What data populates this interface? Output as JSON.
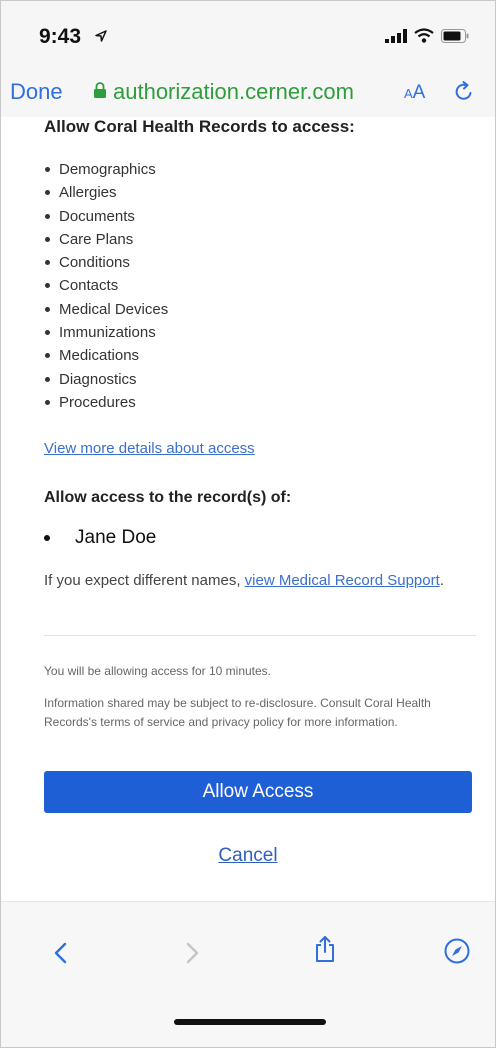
{
  "status_bar": {
    "time": "9:43"
  },
  "browser": {
    "done_label": "Done",
    "url": "authorization.cerner.com",
    "text_size_label_small": "A",
    "text_size_label_large": "A"
  },
  "consent": {
    "access_heading": "Allow Coral Health Records to access:",
    "scopes": [
      "Demographics",
      "Allergies",
      "Documents",
      "Care Plans",
      "Conditions",
      "Contacts",
      "Medical Devices",
      "Immunizations",
      "Medications",
      "Diagnostics",
      "Procedures"
    ],
    "details_link": "View more details about access",
    "records_heading": "Allow access to the record(s) of:",
    "patient_name": "Jane Doe",
    "expect_text": "If you expect different names, ",
    "support_link": "view Medical Record Support",
    "expect_suffix": ".",
    "minutes_note": "You will be allowing access for 10 minutes.",
    "disclosure_note": "Information shared may be subject to re-disclosure. Consult Coral Health Records's terms of service and privacy policy for more information.",
    "allow_button": "Allow Access",
    "cancel_link": "Cancel"
  },
  "colors": {
    "link_blue": "#2f6fe0",
    "url_green": "#2e9d3c",
    "button_blue": "#1f5fd6"
  }
}
